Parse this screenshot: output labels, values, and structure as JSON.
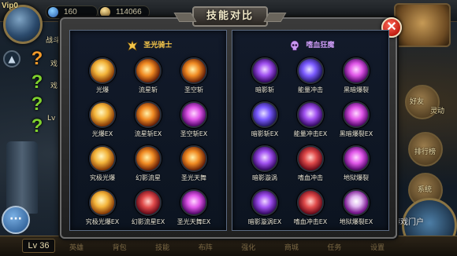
{
  "hud": {
    "vip_label": "Vip0",
    "gems": "160",
    "gold": "114066",
    "level": "Lv 36",
    "left_hints": [
      "战斗",
      "戏",
      "戏",
      "Lv"
    ],
    "right_hints": [
      "好友",
      "灵动",
      "排行榜",
      "系统"
    ],
    "bottom_tabs": [
      "英雄",
      "背包",
      "技能",
      "布阵",
      "强化",
      "商城",
      "任务",
      "设置"
    ],
    "watermark_text": "当乐网游戏门户",
    "watermark_domain": "d.cn"
  },
  "dialog": {
    "title": "技能对比",
    "close_label": "✕",
    "classes": [
      {
        "name": "圣光骑士",
        "emblem_color": "#f5c64a",
        "skills": [
          {
            "label": "光爆",
            "fx": "fx-gold"
          },
          {
            "label": "流星斩",
            "fx": "fx-fire"
          },
          {
            "label": "圣空斩",
            "fx": "fx-fire"
          },
          {
            "label": "光爆EX",
            "fx": "fx-gold"
          },
          {
            "label": "流星斩EX",
            "fx": "fx-fire"
          },
          {
            "label": "圣空斩EX",
            "fx": "fx-magenta"
          },
          {
            "label": "究极光爆",
            "fx": "fx-gold"
          },
          {
            "label": "幻影流星",
            "fx": "fx-fire"
          },
          {
            "label": "圣光天舞",
            "fx": "fx-fire"
          },
          {
            "label": "究极光爆EX",
            "fx": "fx-gold"
          },
          {
            "label": "幻影流星EX",
            "fx": "fx-red"
          },
          {
            "label": "圣光天舞EX",
            "fx": "fx-magenta"
          }
        ]
      },
      {
        "name": "嗜血狂魔",
        "emblem_color": "#c898f0",
        "skills": [
          {
            "label": "暗影斩",
            "fx": "fx-purple"
          },
          {
            "label": "能量冲击",
            "fx": "fx-violet"
          },
          {
            "label": "黑暗爆裂",
            "fx": "fx-magenta"
          },
          {
            "label": "暗影斩EX",
            "fx": "fx-violet"
          },
          {
            "label": "能量冲击EX",
            "fx": "fx-purple"
          },
          {
            "label": "黑暗爆裂EX",
            "fx": "fx-magenta"
          },
          {
            "label": "暗影漩涡",
            "fx": "fx-purple"
          },
          {
            "label": "嗜血冲击",
            "fx": "fx-red"
          },
          {
            "label": "地狱爆裂",
            "fx": "fx-magenta"
          },
          {
            "label": "暗影漩涡EX",
            "fx": "fx-purple"
          },
          {
            "label": "嗜血冲击EX",
            "fx": "fx-red"
          },
          {
            "label": "地狱爆裂EX",
            "fx": "fx-skull"
          }
        ]
      }
    ]
  }
}
